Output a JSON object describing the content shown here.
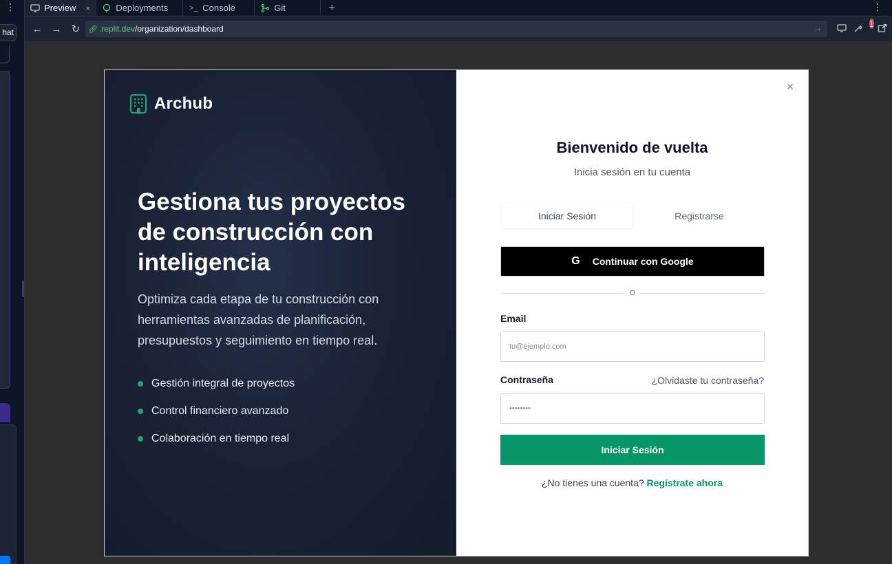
{
  "ide": {
    "left_chip": "hat",
    "tabs": [
      {
        "label": "Preview",
        "icon": "monitor-icon",
        "closable": true
      },
      {
        "label": "Deployments",
        "icon": "deploy-icon"
      },
      {
        "label": "Console",
        "icon": "terminal-icon"
      },
      {
        "label": "Git",
        "icon": "git-icon"
      }
    ],
    "tab_close": "×",
    "add_tab": "+",
    "url_host": ".replit.dev",
    "url_path": "/organization/dashboard",
    "notification_count": "1"
  },
  "modal": {
    "brand": "Archub",
    "hero": "Gestiona tus proyectos de construcción con inteligencia",
    "description": "Optimiza cada etapa de tu construcción con herramientas avanzadas de planificación, presupuestos y seguimiento en tiempo real.",
    "features": [
      "Gestión integral de proyectos",
      "Control financiero avanzado",
      "Colaboración en tiempo real"
    ],
    "close": "×",
    "title": "Bienvenido de vuelta",
    "subtitle": "Inicia sesión en tu cuenta",
    "tab_login": "Iniciar Sesión",
    "tab_register": "Registrarse",
    "google_button": "Continuar con Google",
    "divider": "O",
    "email_label": "Email",
    "email_placeholder": "tu@ejemplo.com",
    "password_label": "Contraseña",
    "password_placeholder": "••••••••",
    "forgot": "¿Olvidaste tu contraseña?",
    "submit": "Iniciar Sesión",
    "no_account": "¿No tienes una cuenta?",
    "register_link": "Regístrate ahora"
  },
  "colors": {
    "accent": "#07956a",
    "dark_panel": "#1a2236"
  }
}
